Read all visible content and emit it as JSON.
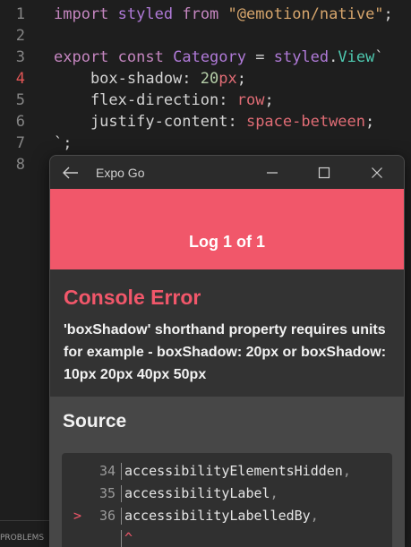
{
  "editor": {
    "lines": [
      {
        "num": "1",
        "tokens": [
          {
            "t": "import",
            "c": "kw"
          },
          {
            "t": " ",
            "c": "plain"
          },
          {
            "t": "styled",
            "c": "kw2"
          },
          {
            "t": " ",
            "c": "plain"
          },
          {
            "t": "from",
            "c": "kw"
          },
          {
            "t": " ",
            "c": "plain"
          },
          {
            "t": "\"@emotion/native\"",
            "c": "str"
          },
          {
            "t": ";",
            "c": "plain"
          }
        ]
      },
      {
        "num": "2",
        "tokens": []
      },
      {
        "num": "3",
        "tokens": [
          {
            "t": "export",
            "c": "kw"
          },
          {
            "t": " ",
            "c": "plain"
          },
          {
            "t": "const",
            "c": "kw"
          },
          {
            "t": " ",
            "c": "plain"
          },
          {
            "t": "Category",
            "c": "kw2"
          },
          {
            "t": " = ",
            "c": "plain"
          },
          {
            "t": "styled",
            "c": "kw2"
          },
          {
            "t": ".",
            "c": "plain"
          },
          {
            "t": "View",
            "c": "tag"
          },
          {
            "t": "`",
            "c": "plain"
          }
        ]
      },
      {
        "num": "4",
        "active": true,
        "tokens": [
          {
            "t": "    box-shadow",
            "c": "prop"
          },
          {
            "t": ": ",
            "c": "plain"
          },
          {
            "t": "20",
            "c": "num"
          },
          {
            "t": "px",
            "c": "unit"
          },
          {
            "t": ";",
            "c": "plain"
          }
        ]
      },
      {
        "num": "5",
        "tokens": [
          {
            "t": "    flex-direction",
            "c": "prop"
          },
          {
            "t": ": ",
            "c": "plain"
          },
          {
            "t": "row",
            "c": "val"
          },
          {
            "t": ";",
            "c": "plain"
          }
        ]
      },
      {
        "num": "6",
        "tokens": [
          {
            "t": "    justify-content",
            "c": "prop"
          },
          {
            "t": ": ",
            "c": "plain"
          },
          {
            "t": "space-between",
            "c": "val"
          },
          {
            "t": ";",
            "c": "plain"
          }
        ]
      },
      {
        "num": "7",
        "tokens": [
          {
            "t": "`",
            "c": "plain"
          },
          {
            "t": ";",
            "c": "plain"
          }
        ]
      },
      {
        "num": "8",
        "tokens": []
      }
    ],
    "bottom_tab": "PROBLEMS"
  },
  "window": {
    "title": "Expo Go",
    "log_header": "Log 1 of 1",
    "error": {
      "title": "Console Error",
      "message": "'boxShadow' shorthand property requires units for example - boxShadow: 20px or boxShadow: 10px 20px 40px 50px"
    },
    "source": {
      "title": "Source",
      "lines": [
        {
          "marker": "",
          "num": "34",
          "text": "accessibilityElementsHidden",
          "punct": ","
        },
        {
          "marker": "",
          "num": "35",
          "text": "accessibilityLabel",
          "punct": ","
        },
        {
          "marker": ">",
          "num": "36",
          "text": "accessibilityLabelledBy",
          "punct": ","
        },
        {
          "marker": "",
          "num": "",
          "text": "",
          "punct": "",
          "caret": "^"
        }
      ]
    }
  },
  "icons": {
    "back": "arrow-left-icon",
    "minimize": "minimize-icon",
    "maximize": "maximize-icon",
    "close": "close-icon"
  },
  "colors": {
    "accent": "#f1576a",
    "editor_bg": "#1e1e1e",
    "titlebar_bg": "#2b2b2b"
  }
}
